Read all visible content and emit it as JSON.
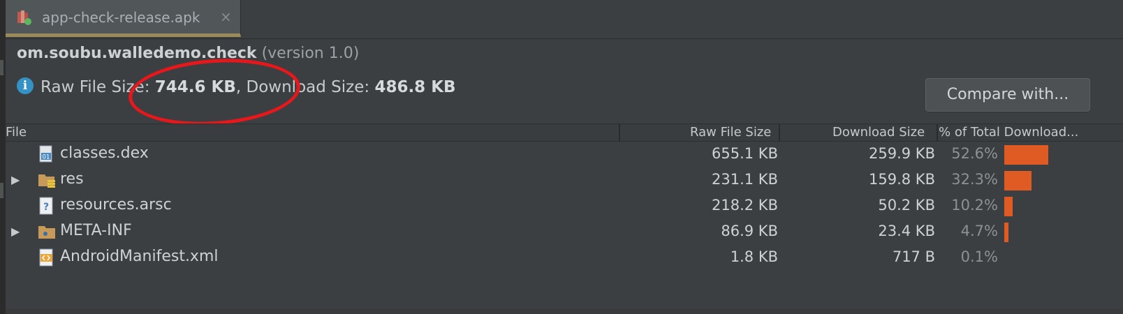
{
  "tab": {
    "label": "app-check-release.apk",
    "close": "×",
    "icon": "apk-file-icon"
  },
  "header": {
    "package": "om.soubu.walledemo.check",
    "version_open": "(version ",
    "version": "1.0",
    "version_close": ")"
  },
  "info": {
    "icon_glyph": "i",
    "raw_label": "Raw File Size: ",
    "raw_value": "744.6 KB",
    "download_label": ", Download Size: ",
    "download_value": "486.8 KB"
  },
  "compare_button": "Compare with...",
  "table": {
    "columns": {
      "file": "File",
      "raw": "Raw File Size",
      "download": "Download Size",
      "percent": "% of Total Download..."
    },
    "rows": [
      {
        "expandable": false,
        "icon": "dex-file-icon",
        "name": "classes.dex",
        "raw": "655.1 KB",
        "download": "259.9 KB",
        "percent": "52.6%",
        "share": 0.526
      },
      {
        "expandable": true,
        "icon": "resource-folder-icon",
        "name": "res",
        "raw": "231.1 KB",
        "download": "159.8 KB",
        "percent": "32.3%",
        "share": 0.323
      },
      {
        "expandable": false,
        "icon": "unknown-file-icon",
        "name": "resources.arsc",
        "raw": "218.2 KB",
        "download": "50.2 KB",
        "percent": "10.2%",
        "share": 0.102
      },
      {
        "expandable": true,
        "icon": "folder-icon",
        "name": "META-INF",
        "raw": "86.9 KB",
        "download": "23.4 KB",
        "percent": "4.7%",
        "share": 0.047
      },
      {
        "expandable": false,
        "icon": "xml-file-icon",
        "name": "AndroidManifest.xml",
        "raw": "1.8 KB",
        "download": "717 B",
        "percent": "0.1%",
        "share": 0.001
      }
    ]
  },
  "colors": {
    "bar": "#e05a24",
    "annotation_circle": "#e8171b",
    "info_icon": "#3592c4",
    "background": "#3c3f41"
  }
}
